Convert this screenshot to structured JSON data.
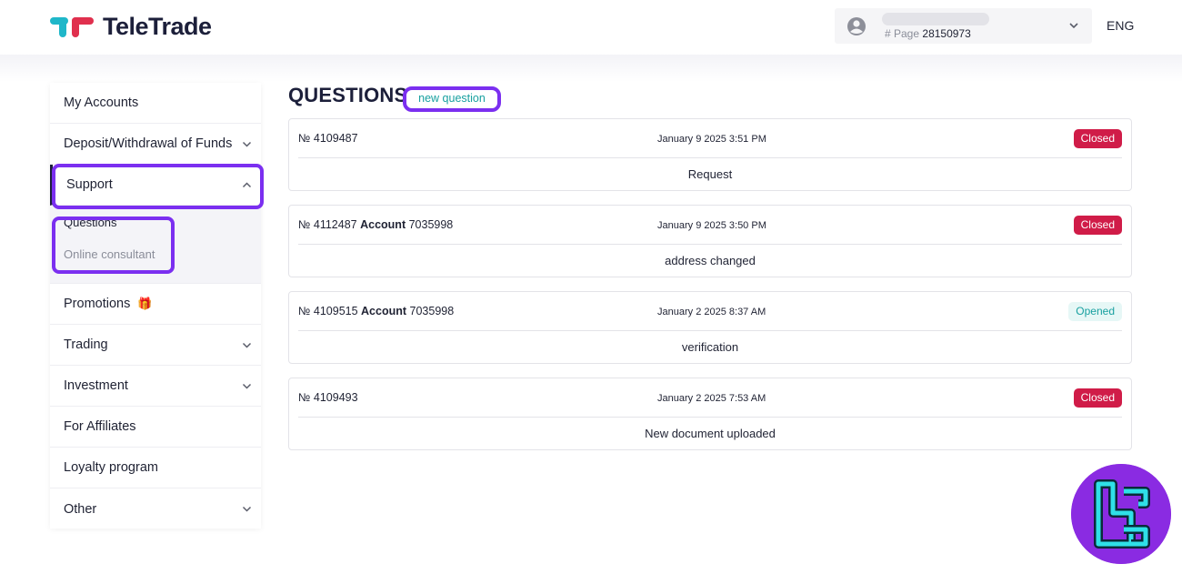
{
  "header": {
    "brand": "TeleTrade",
    "page_label": "# Page",
    "page_number": "28150973",
    "language": "ENG"
  },
  "sidebar": {
    "items": [
      {
        "label": "My Accounts"
      },
      {
        "label": "Deposit/Withdrawal of Funds"
      },
      {
        "label": "Support"
      },
      {
        "label": "Promotions"
      },
      {
        "label": "Trading"
      },
      {
        "label": "Investment"
      },
      {
        "label": "For Affiliates"
      },
      {
        "label": "Loyalty program"
      },
      {
        "label": "Other"
      }
    ],
    "support_sub": {
      "questions": "Questions",
      "online_consultant": "Online consultant"
    }
  },
  "main": {
    "title": "QUESTIONS",
    "new_question": "new question",
    "tickets": [
      {
        "no_prefix": "№ 4109487",
        "account_label": "",
        "account_no": "",
        "date": "January 9 2025 3:51 PM",
        "status": "Closed",
        "subject": "Request"
      },
      {
        "no_prefix": "№ 4112487",
        "account_label": "Account",
        "account_no": "7035998",
        "date": "January 9 2025 3:50 PM",
        "status": "Closed",
        "subject": "address changed"
      },
      {
        "no_prefix": "№ 4109515",
        "account_label": "Account",
        "account_no": "7035998",
        "date": "January 2 2025 8:37 AM",
        "status": "Opened",
        "subject": "verification"
      },
      {
        "no_prefix": "№ 4109493",
        "account_label": "",
        "account_no": "",
        "date": "January 2 2025 7:53 AM",
        "status": "Closed",
        "subject": "New document uploaded"
      }
    ]
  },
  "colors": {
    "brand_dark": "#1c1f3a",
    "accent_purple": "#7b2ff0",
    "closed_red": "#d01c48",
    "opened_teal": "#18a0a0"
  }
}
